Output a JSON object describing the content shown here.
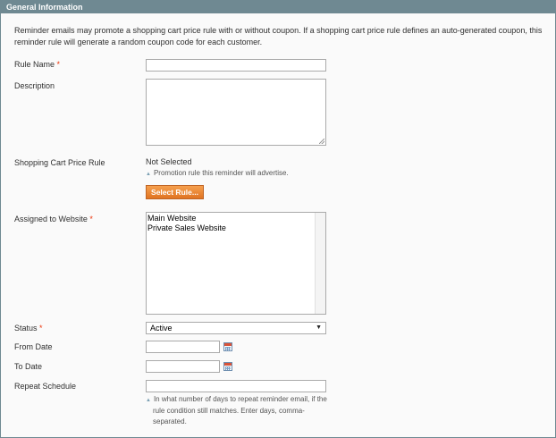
{
  "section": {
    "title": "General Information",
    "intro_line1": "Reminder emails may promote a shopping cart price rule with or without coupon. If a shopping cart price rule defines an auto-generated coupon, this",
    "intro_line2": "reminder rule will generate a random coupon code for each customer."
  },
  "fields": {
    "rule_name": {
      "label": "Rule Name",
      "required": "*",
      "value": ""
    },
    "description": {
      "label": "Description",
      "value": ""
    },
    "price_rule": {
      "label": "Shopping Cart Price Rule",
      "value": "Not Selected",
      "note": "Promotion rule this reminder will advertise.",
      "button": "Select Rule..."
    },
    "website": {
      "label": "Assigned to Website",
      "required": "*",
      "options": [
        "Main Website",
        "Private Sales Website"
      ]
    },
    "status": {
      "label": "Status",
      "required": "*",
      "selected": "Active"
    },
    "from_date": {
      "label": "From Date",
      "value": ""
    },
    "to_date": {
      "label": "To Date",
      "value": ""
    },
    "repeat": {
      "label": "Repeat Schedule",
      "value": "",
      "note_line1": "In what number of days to repeat reminder email, if the",
      "note_line2": "rule condition still matches. Enter days, comma-",
      "note_line3": "separated."
    }
  },
  "icons": {
    "note": "triangle-up-icon",
    "calendar": "calendar-icon",
    "dropdown": "chevron-down-icon"
  },
  "colors": {
    "header_bg": "#6f8992",
    "button_bg": "#eb7d2a",
    "required": "#eb340a"
  }
}
